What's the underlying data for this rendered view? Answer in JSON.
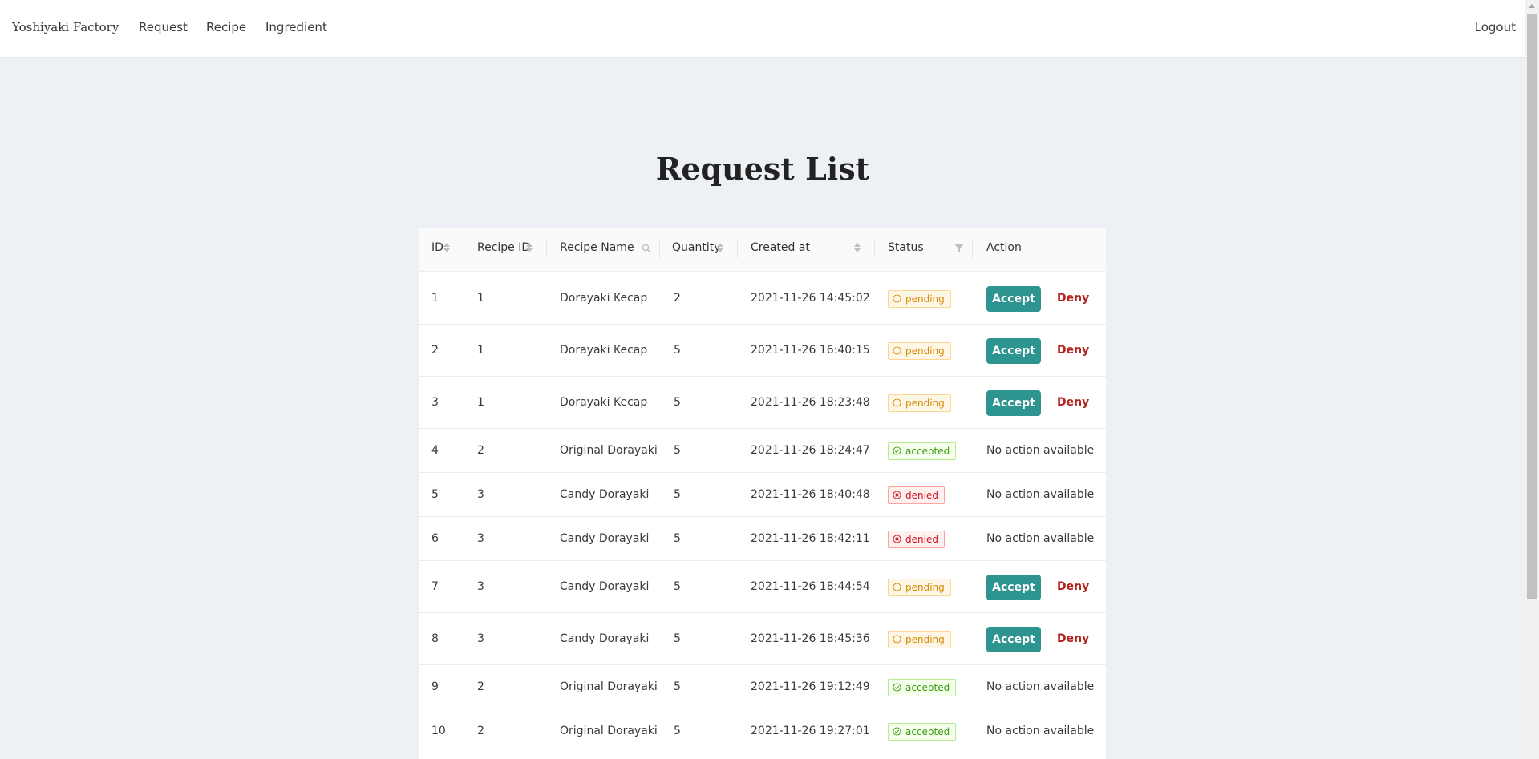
{
  "nav": {
    "brand": "Yoshiyaki Factory",
    "links": [
      "Request",
      "Recipe",
      "Ingredient"
    ],
    "logout": "Logout"
  },
  "page": {
    "title": "Request List"
  },
  "table": {
    "columns": [
      "ID",
      "Recipe ID",
      "Recipe Name",
      "Quantity",
      "Created at",
      "Status",
      "Action"
    ],
    "accept_label": "Accept",
    "deny_label": "Deny",
    "no_action_label": "No action available",
    "rows": [
      {
        "id": "1",
        "recipe_id": "1",
        "recipe_name": "Dorayaki Kecap",
        "quantity": "2",
        "created_at": "2021-11-26 14:45:02",
        "status": "pending"
      },
      {
        "id": "2",
        "recipe_id": "1",
        "recipe_name": "Dorayaki Kecap",
        "quantity": "5",
        "created_at": "2021-11-26 16:40:15",
        "status": "pending"
      },
      {
        "id": "3",
        "recipe_id": "1",
        "recipe_name": "Dorayaki Kecap",
        "quantity": "5",
        "created_at": "2021-11-26 18:23:48",
        "status": "pending"
      },
      {
        "id": "4",
        "recipe_id": "2",
        "recipe_name": "Original Dorayaki",
        "quantity": "5",
        "created_at": "2021-11-26 18:24:47",
        "status": "accepted"
      },
      {
        "id": "5",
        "recipe_id": "3",
        "recipe_name": "Candy Dorayaki",
        "quantity": "5",
        "created_at": "2021-11-26 18:40:48",
        "status": "denied"
      },
      {
        "id": "6",
        "recipe_id": "3",
        "recipe_name": "Candy Dorayaki",
        "quantity": "5",
        "created_at": "2021-11-26 18:42:11",
        "status": "denied"
      },
      {
        "id": "7",
        "recipe_id": "3",
        "recipe_name": "Candy Dorayaki",
        "quantity": "5",
        "created_at": "2021-11-26 18:44:54",
        "status": "pending"
      },
      {
        "id": "8",
        "recipe_id": "3",
        "recipe_name": "Candy Dorayaki",
        "quantity": "5",
        "created_at": "2021-11-26 18:45:36",
        "status": "pending"
      },
      {
        "id": "9",
        "recipe_id": "2",
        "recipe_name": "Original Dorayaki",
        "quantity": "5",
        "created_at": "2021-11-26 19:12:49",
        "status": "accepted"
      },
      {
        "id": "10",
        "recipe_id": "2",
        "recipe_name": "Original Dorayaki",
        "quantity": "5",
        "created_at": "2021-11-26 19:27:01",
        "status": "accepted"
      }
    ]
  },
  "colors": {
    "accent": "#2e9490",
    "deny": "#b2231f",
    "background": "#edf1f5"
  },
  "icons": {
    "pending": "exclamation-circle-icon",
    "accepted": "check-circle-icon",
    "denied": "close-circle-icon",
    "sort": "sort-icon",
    "search": "search-icon",
    "filter": "filter-icon"
  }
}
